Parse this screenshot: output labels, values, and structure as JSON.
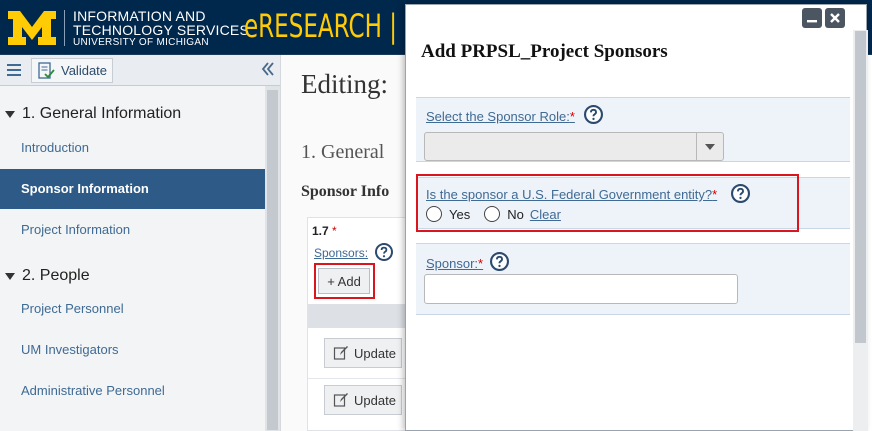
{
  "header": {
    "logo_letter": "M",
    "org_line1": "INFORMATION AND",
    "org_line2": "TECHNOLOGY SERVICES",
    "org_line3": "UNIVERSITY OF MICHIGAN",
    "brand": "eRESEARCH | P"
  },
  "toolbar": {
    "validate_label": "Validate"
  },
  "sidebar": {
    "sections": [
      {
        "label": "1. General Information",
        "items": [
          "Introduction",
          "Sponsor Information",
          "Project Information"
        ]
      },
      {
        "label": "2. People",
        "items": [
          "Project Personnel",
          "UM Investigators",
          "Administrative Personnel"
        ]
      }
    ],
    "active_item": "Sponsor Information"
  },
  "main": {
    "heading": "Editing:",
    "section_heading": "1. General",
    "subsection_heading": "Sponsor Info",
    "question_number": "1.7",
    "required_mark": "*",
    "question_label": "Sponsors:",
    "add_label": "+ Add",
    "update_label": "Update"
  },
  "dialog": {
    "title": "Add PRPSL_Project Sponsors",
    "fields": {
      "role": {
        "label": "Select the Sponsor Role:",
        "required": "*",
        "value": ""
      },
      "federal": {
        "label": "Is the sponsor a U.S. Federal Government entity?",
        "required": "*",
        "options": [
          "Yes",
          "No"
        ],
        "clear_label": "Clear"
      },
      "sponsor": {
        "label": "Sponsor:",
        "required": "*",
        "value": ""
      }
    }
  },
  "colors": {
    "header_bg": "#00274c",
    "maize": "#ffcb05",
    "active_nav": "#2d5a86",
    "link": "#3f6a94",
    "highlight": "#d9161d"
  }
}
